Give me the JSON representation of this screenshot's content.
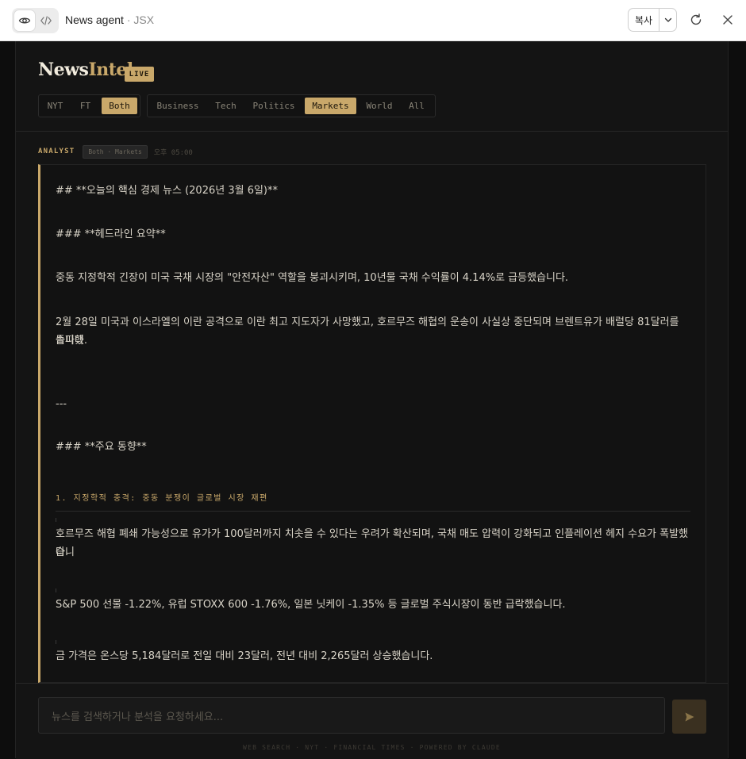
{
  "window": {
    "title": "News agent",
    "type": "JSX",
    "copy_label": "복사"
  },
  "brand": {
    "part1": "News",
    "part2": "Intel",
    "badge": "LIVE"
  },
  "source_filters": [
    {
      "label": "NYT",
      "active": false
    },
    {
      "label": "FT",
      "active": false
    },
    {
      "label": "Both",
      "active": true
    }
  ],
  "category_filters": [
    {
      "label": "Business",
      "active": false
    },
    {
      "label": "Tech",
      "active": false
    },
    {
      "label": "Politics",
      "active": false
    },
    {
      "label": "Markets",
      "active": true
    },
    {
      "label": "World",
      "active": false
    },
    {
      "label": "All",
      "active": false
    }
  ],
  "message": {
    "author": "ANALYST",
    "tag": "Both · Markets",
    "time": "오후 05:00",
    "lines": {
      "title": "## **오늘의 핵심 경제 뉴스 (2026년 3월 6일)**",
      "headline_heading": "### **헤드라인 요약**",
      "headline_1": "중동 지정학적 긴장이 미국 국채 시장의 \"안전자산\" 역할을 붕괴시키며, 10년물 국채 수익률이 4.14%로 급등했습니다.",
      "headline_2a": "2월 28일 미국과 이스라엘의 이란 공격으로 이란 최고 지도자가 사망했고, 호르무즈 해협의 운송이 사실상 중단되며 브렌트유가 배럴당 81달러를 돌파했",
      "headline_2b": "습니다.",
      "divider": "---",
      "trends_heading": "### **주요 동향**",
      "section_1": "1. 지정학적 충격: 중동 분쟁이 글로벌 시장 재편",
      "bullet_1a": "호르무즈 해협 폐쇄 가능성으로 유가가 100달러까지 치솟을 수 있다는 우려가 확산되며, 국채 매도 압력이 강화되고 인플레이션 헤지 수요가 폭발했습니",
      "bullet_1b": "다.",
      "bullet_2": "S&P 500 선물 -1.22%, 유럽 STOXX 600 -1.76%, 일본 닛케이 -1.35% 등 글로벌 주식시장이 동반 급락했습니다.",
      "bullet_3": "금 가격은 온스당 5,184달러로 전일 대비 23달러, 전년 대비 2,265달러 상승했습니다."
    }
  },
  "composer": {
    "placeholder": "뉴스를 검색하거나 분석을 요청하세요...",
    "credits": "WEB SEARCH · NYT · FINANCIAL TIMES · POWERED BY CLAUDE"
  },
  "colors": {
    "accent": "#c9a86a",
    "background": "#141414",
    "text": "#d9d4c8"
  }
}
